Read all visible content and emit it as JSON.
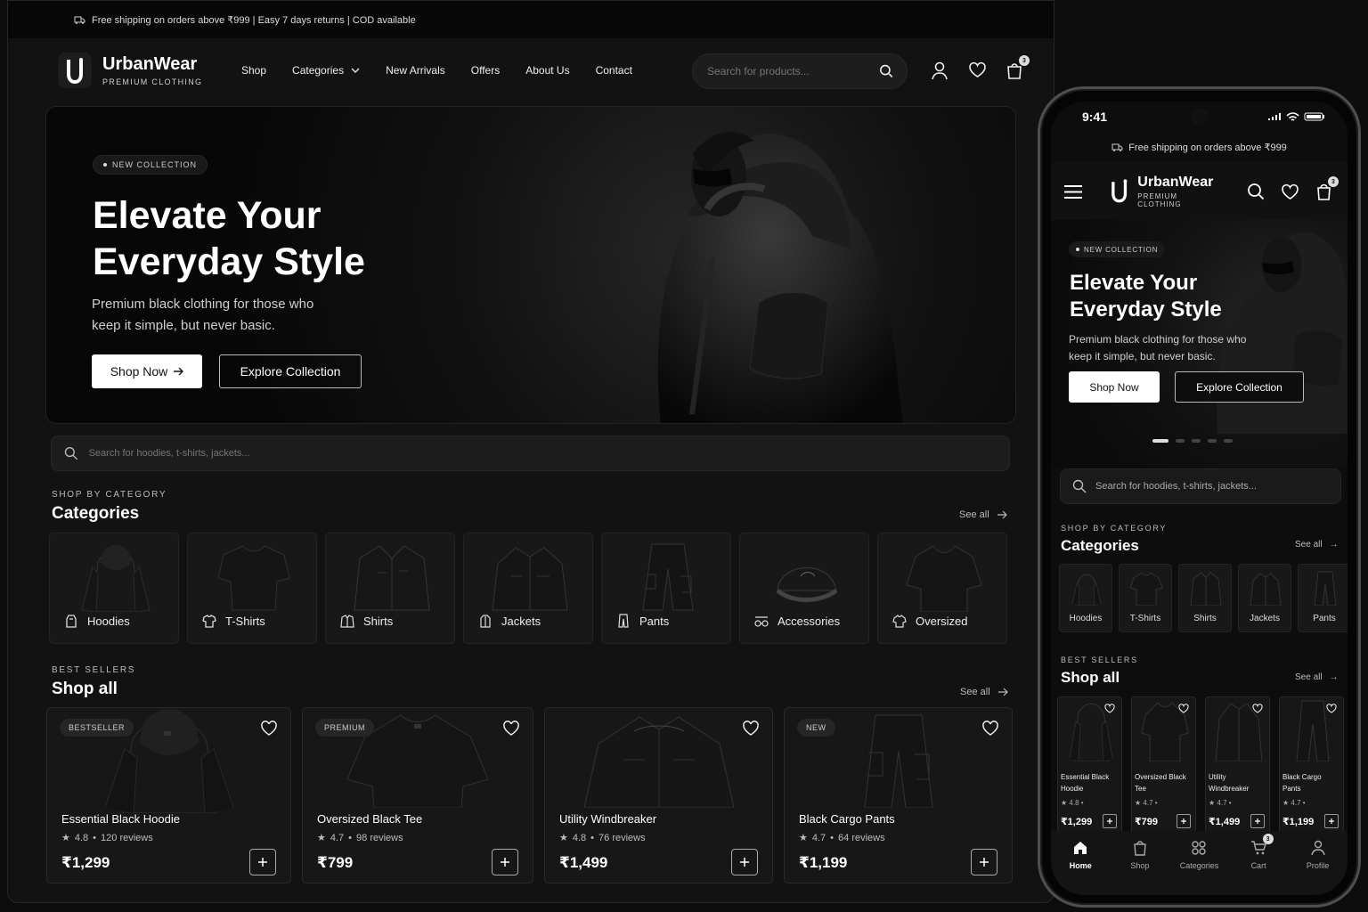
{
  "desktop": {
    "promo": "Free shipping on orders above ₹999 | Easy 7 days returns | COD available",
    "brand": "UrbanWear",
    "tagline": "PREMIUM CLOTHING",
    "nav": [
      "Shop",
      "Categories",
      "New Arrivals",
      "Offers",
      "About Us",
      "Contact"
    ],
    "search_placeholder": "Search for products...",
    "cart_count": "3",
    "hero": {
      "pill": "NEW COLLECTION",
      "title": "Elevate Your Everyday Style",
      "description": "Premium black clothing for those who keep it simple, but never basic.",
      "primary": "Shop Now",
      "secondary": "Explore Collection"
    },
    "catalog_search": "Search for hoodies, t-shirts, jackets...",
    "categories": {
      "kicker": "SHOP BY CATEGORY",
      "title": "Categories",
      "see_all": "See all",
      "items": [
        "Hoodies",
        "T-Shirts",
        "Shirts",
        "Jackets",
        "Pants",
        "Accessories",
        "Oversized"
      ]
    },
    "products": {
      "kicker": "BEST SELLERS",
      "title": "Shop all",
      "see_all": "See all",
      "items": [
        {
          "badge": "BESTSELLER",
          "name": "Essential Black Hoodie",
          "rating": "4.8",
          "reviews": "120 reviews",
          "price": "₹1,299"
        },
        {
          "badge": "PREMIUM",
          "name": "Oversized Black Tee",
          "rating": "4.7",
          "reviews": "98 reviews",
          "price": "₹799"
        },
        {
          "badge": "",
          "name": "Utility Windbreaker",
          "rating": "4.8",
          "reviews": "76 reviews",
          "price": "₹1,499"
        },
        {
          "badge": "NEW",
          "name": "Black Cargo Pants",
          "rating": "4.7",
          "reviews": "64 reviews",
          "price": "₹1,199"
        }
      ]
    }
  },
  "mobile": {
    "time": "9:41",
    "promo": "Free shipping on orders above ₹999",
    "brand": "UrbanWear",
    "tagline": "PREMIUM CLOTHING",
    "cart_count": "3",
    "hero": {
      "pill": "NEW COLLECTION",
      "title": "Elevate Your Everyday Style",
      "description": "Premium black clothing for those who keep it simple, but never basic.",
      "primary": "Shop Now",
      "secondary": "Explore Collection"
    },
    "search": "Search for hoodies, t-shirts, jackets...",
    "categories": {
      "kicker": "SHOP BY CATEGORY",
      "title": "Categories",
      "see_all": "See all",
      "items": [
        "Hoodies",
        "T-Shirts",
        "Shirts",
        "Jackets",
        "Pants"
      ]
    },
    "products": {
      "kicker": "BEST SELLERS",
      "title": "Shop all",
      "see_all": "See all",
      "items": [
        {
          "name": "Essential Black Hoodie",
          "rating": "4.8",
          "price": "₹1,299"
        },
        {
          "name": "Oversized Black Tee",
          "rating": "4.7",
          "price": "₹799"
        },
        {
          "name": "Utility Windbreaker",
          "rating": "4.7",
          "price": "₹1,499"
        },
        {
          "name": "Black Cargo Pants",
          "rating": "4.7",
          "price": "₹1,199"
        }
      ]
    },
    "tabs": [
      "Home",
      "Shop",
      "Categories",
      "Cart",
      "Profile"
    ]
  }
}
